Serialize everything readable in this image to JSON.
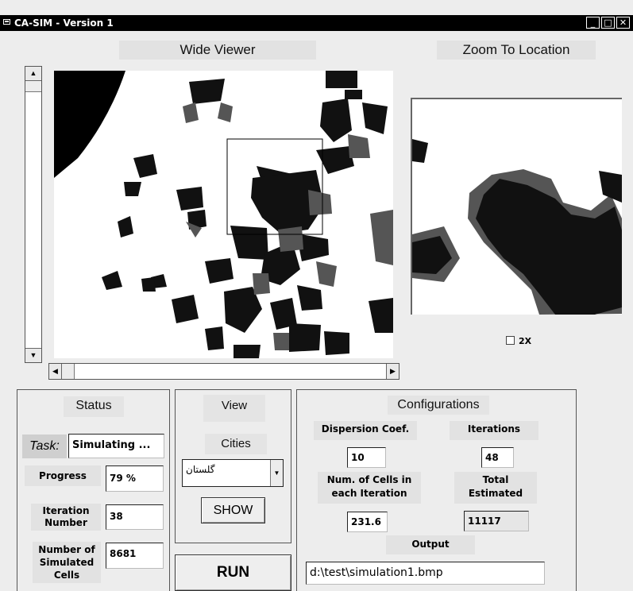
{
  "window": {
    "title": "CA-SIM - Version 1",
    "min_glyph": "_",
    "max_glyph": "□",
    "close_glyph": "✕"
  },
  "viewer": {
    "wide_title": "Wide Viewer",
    "zoom_title": "Zoom To Location",
    "zoom_2x_label": "2X",
    "zoom_2x_checked": false
  },
  "scroll": {
    "up": "▲",
    "down": "▼",
    "left": "◀",
    "right": "▶"
  },
  "status": {
    "title": "Status",
    "task_label": "Task:",
    "task_value": "Simulating ...",
    "progress_label": "Progress",
    "progress_value": "79 %",
    "iteration_label_1": "Iteration",
    "iteration_label_2": "Number",
    "iteration_value": "38",
    "simulated_label_1": "Number of",
    "simulated_label_2": "Simulated",
    "simulated_label_3": "Cells",
    "simulated_value": "8681"
  },
  "view": {
    "title": "View",
    "cities_label": "Cities",
    "city_selected": "گلستان",
    "show_button": "SHOW",
    "run_button": "RUN"
  },
  "config": {
    "title": "Configurations",
    "dispersion_label": "Dispersion Coef.",
    "dispersion_value": "10",
    "iterations_label": "Iterations",
    "iterations_value": "48",
    "cells_label_1": "Num. of Cells in",
    "cells_label_2": "each Iteration",
    "cells_value": "231.6",
    "total_label_1": "Total",
    "total_label_2": "Estimated",
    "total_value": "11117",
    "output_label": "Output",
    "output_value": "d:\\test\\simulation1.bmp"
  },
  "colors": {
    "urban_old": "#111111",
    "urban_new": "#555555",
    "background": "#ffffff"
  }
}
